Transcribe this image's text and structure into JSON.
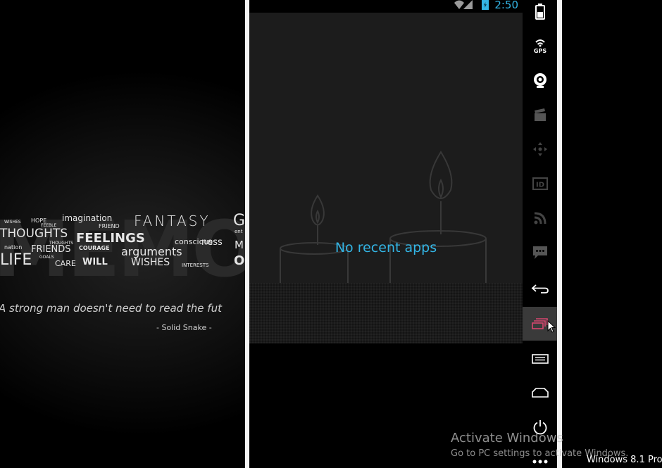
{
  "wallpaper": {
    "ghost_art": "MEMO",
    "words": [
      "imagination",
      "FANTASY",
      "G",
      "WISHES",
      "HOPE",
      "FEEBLE",
      "FRIEND",
      "THOUGHTS",
      "FEELINGS",
      "ent",
      "nation",
      "FRIENDS",
      "THOUGHTS",
      "COURAGE",
      "arguments",
      "conscious",
      "ness",
      "M",
      "LIFE",
      "GOALS",
      "CARE",
      "WILL",
      "WISHES",
      "INTERESTS",
      "O"
    ],
    "quote": "A strong man doesn't need to read the fut",
    "author": "- Solid Snake -"
  },
  "android": {
    "status_time": "2:50",
    "empty_message": "No recent apps",
    "accent_color": "#33b5e5"
  },
  "toolbar": {
    "gps_label": "GPS",
    "id_label": "ID",
    "icons": [
      "battery-icon",
      "gps-icon",
      "camera-icon",
      "clapperboard-icon",
      "dpad-icon",
      "id-icon",
      "rss-icon",
      "sms-icon",
      "back-icon",
      "recent-apps-icon",
      "menu-icon",
      "home-icon",
      "power-icon",
      "more-icon"
    ],
    "active_item": "recent-apps"
  },
  "watermark": {
    "title": "Activate Windows",
    "subtitle": "Go to PC settings to activate Windows.",
    "os_label": "Windows 8.1 Pro"
  }
}
